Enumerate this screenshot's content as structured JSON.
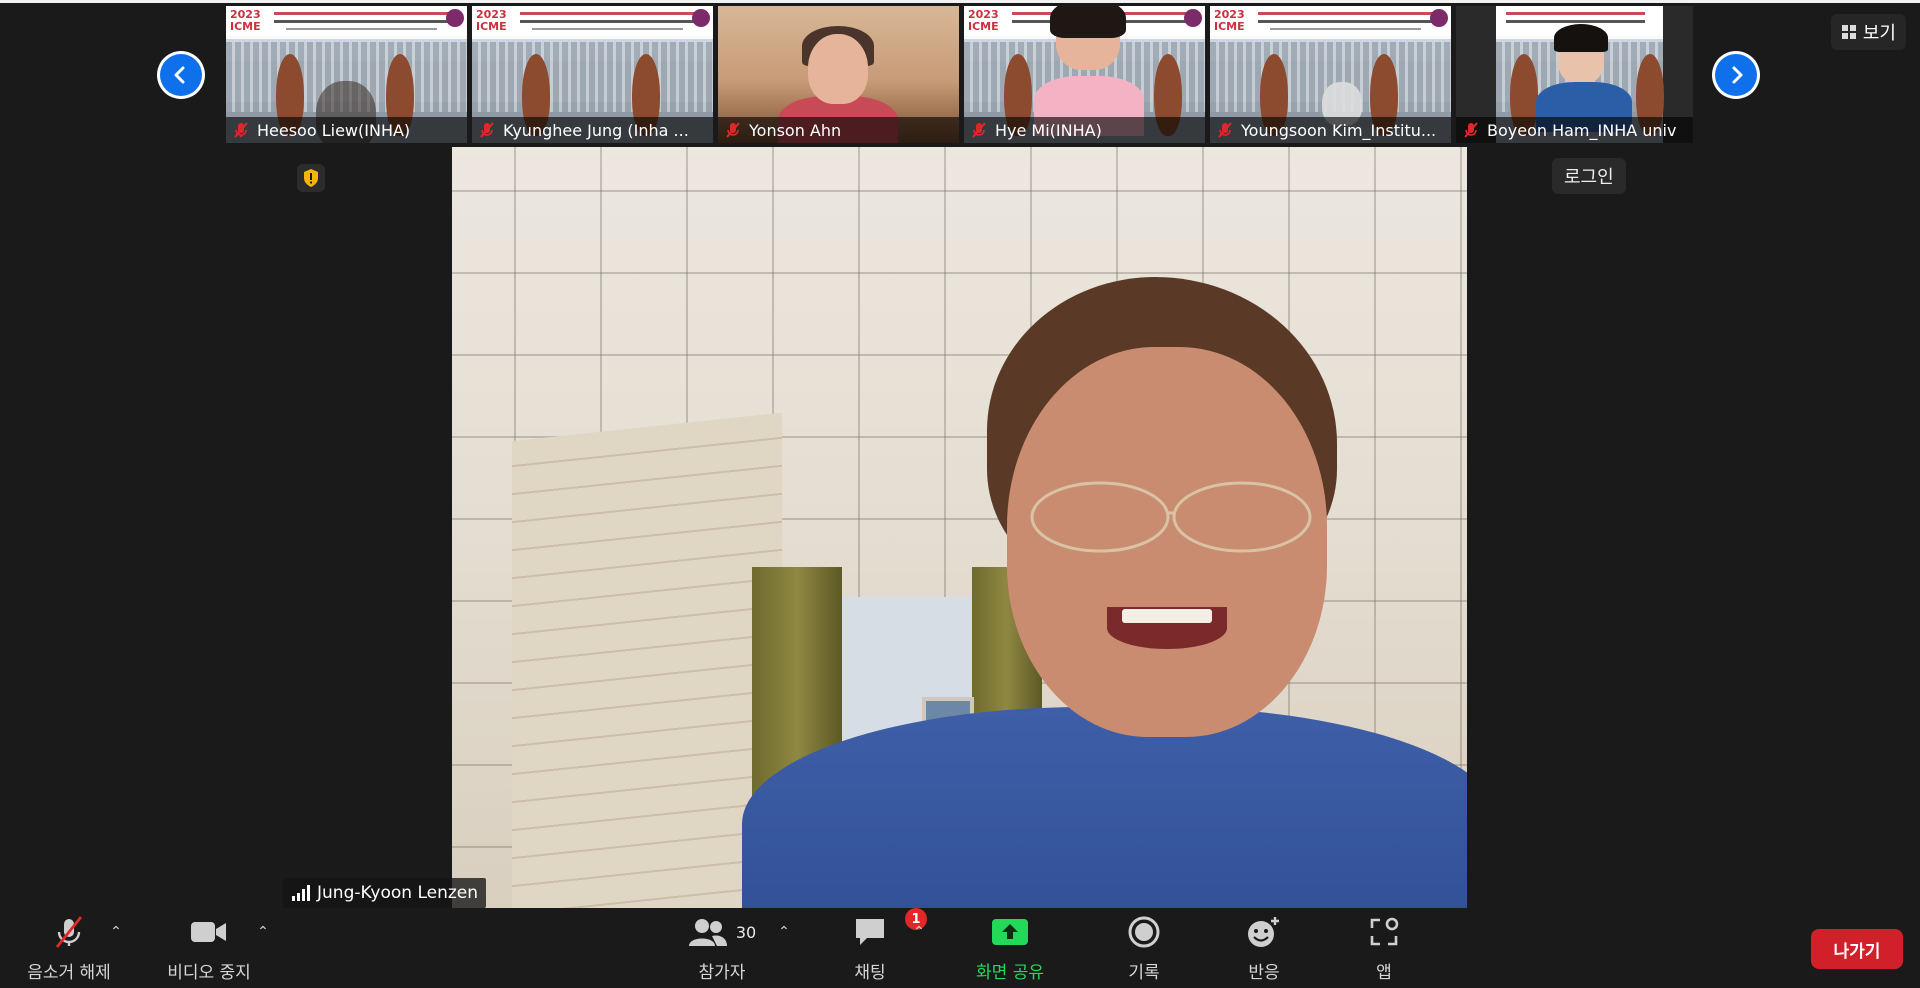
{
  "thumbnails": [
    {
      "name": "Heesoo Liew(INHA)",
      "bg": "slide"
    },
    {
      "name": "Kyunghee Jung (Inha ...",
      "bg": "slide"
    },
    {
      "name": "Yonson Ahn",
      "bg": "room"
    },
    {
      "name": "Hye Mi(INHA)",
      "bg": "slide"
    },
    {
      "name": "Youngsoon Kim_Institu...",
      "bg": "slide"
    },
    {
      "name": "Boyeon Ham_INHA univ",
      "bg": "slide"
    }
  ],
  "slide_text": {
    "year": "2023",
    "short": "ICME"
  },
  "login_tip": "로그인",
  "view_label": "보기",
  "active_speaker": "Jung-Kyoon Lenzen",
  "toolbar": {
    "unmute_label": "음소거 해제",
    "stop_video_label": "비디오 중지",
    "participants_label": "참가자",
    "participants_count": "30",
    "chat_label": "채팅",
    "chat_badge": "1",
    "share_label": "화면 공유",
    "record_label": "기록",
    "reactions_label": "반응",
    "apps_label": "앱",
    "leave_label": "나가기"
  },
  "colors": {
    "accent_blue": "#0e71eb",
    "share_green": "#23d959",
    "leave_red": "#d2202a",
    "muted_red": "#e02828"
  }
}
